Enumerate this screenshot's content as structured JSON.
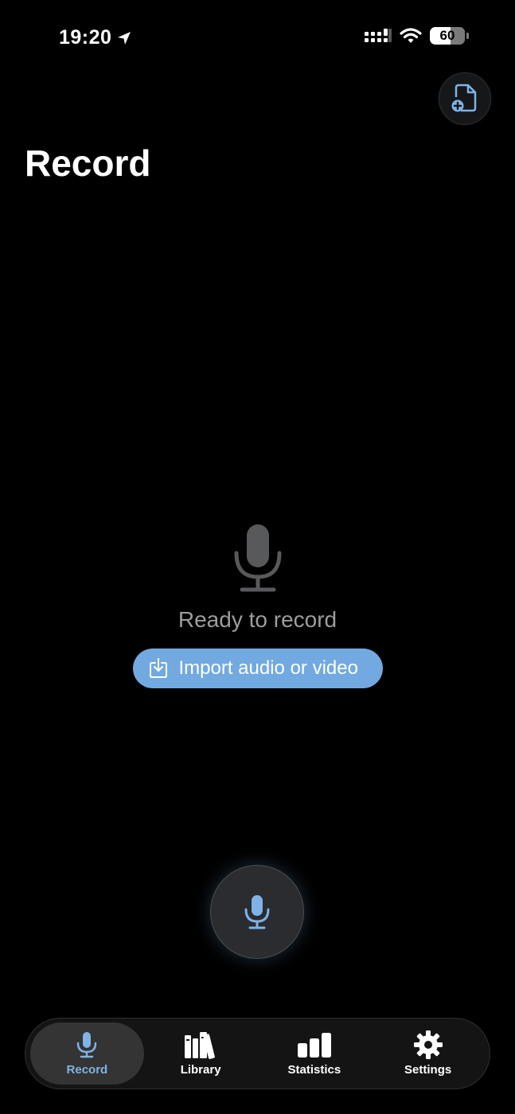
{
  "status_bar": {
    "time": "19:20",
    "battery": "60",
    "icons": [
      "location-arrow-icon",
      "cellular-signal-icon",
      "wifi-icon",
      "battery-icon"
    ]
  },
  "header": {
    "title": "Record",
    "new_document_icon": "document-plus-icon"
  },
  "empty_state": {
    "icon": "microphone-icon",
    "message": "Ready to record",
    "import_label": "Import audio or video",
    "import_icon": "import-tray-icon"
  },
  "record_button": {
    "icon": "microphone-icon"
  },
  "tab_bar": {
    "tabs": [
      {
        "label": "Record",
        "icon": "microphone-icon",
        "active": true
      },
      {
        "label": "Library",
        "icon": "books-icon",
        "active": false
      },
      {
        "label": "Statistics",
        "icon": "bar-chart-icon",
        "active": false
      },
      {
        "label": "Settings",
        "icon": "gear-icon",
        "active": false
      }
    ]
  },
  "colors": {
    "accent": "#72a9e0",
    "background": "#000000",
    "active_tab_text": "#7fb3e6"
  }
}
